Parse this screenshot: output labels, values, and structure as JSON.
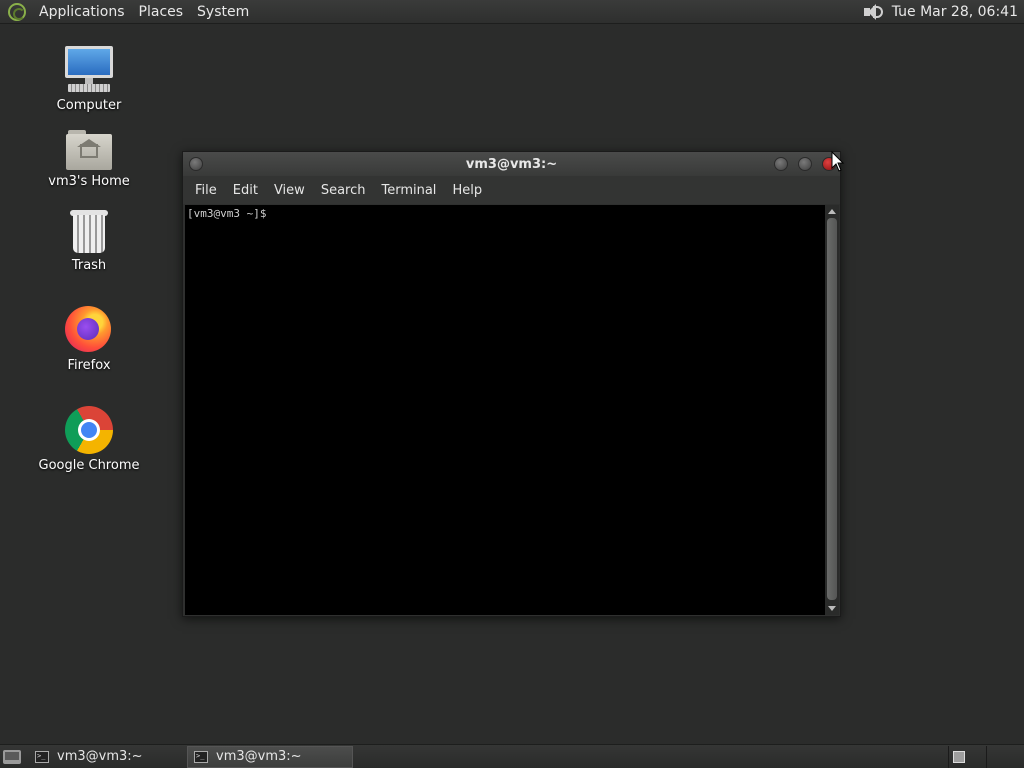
{
  "top_panel": {
    "menus": [
      "Applications",
      "Places",
      "System"
    ],
    "clock": "Tue Mar 28, 06:41"
  },
  "desktop": {
    "icons": [
      {
        "label": "Computer",
        "icon": "computer-icon"
      },
      {
        "label": "vm3's Home",
        "icon": "home-folder-icon"
      },
      {
        "label": "Trash",
        "icon": "trash-icon"
      },
      {
        "label": "Firefox",
        "icon": "firefox-icon"
      },
      {
        "label": "Google Chrome",
        "icon": "chrome-icon"
      }
    ]
  },
  "terminal_window": {
    "title": "vm3@vm3:~",
    "menu": [
      "File",
      "Edit",
      "View",
      "Search",
      "Terminal",
      "Help"
    ],
    "prompt": "[vm3@vm3 ~]$"
  },
  "bottom_panel": {
    "tasks": [
      {
        "label": "vm3@vm3:~",
        "active": false
      },
      {
        "label": "vm3@vm3:~",
        "active": true
      }
    ]
  },
  "colors": {
    "desktop_bg": "#2b2c2b",
    "terminal_bg": "#000000",
    "close_button": "#d03030"
  }
}
